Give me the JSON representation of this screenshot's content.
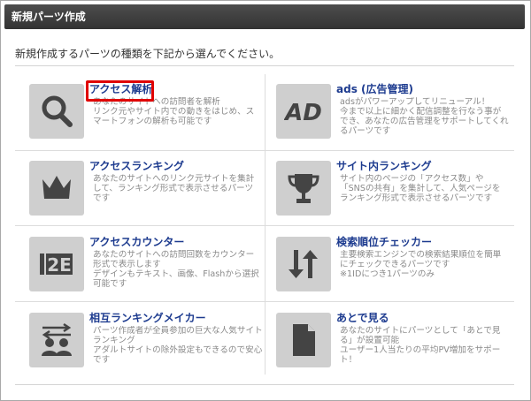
{
  "header": {
    "title": "新規パーツ作成"
  },
  "intro": "新規作成するパーツの種類を下記から選んでください。",
  "items": [
    {
      "title": "アクセス解析",
      "icon": "magnifier-icon",
      "desc": [
        "あなたのサイトへの訪問者を解析",
        "リンク元やサイト内での動きをはじめ、ス",
        "マートフォンの解析も可能です"
      ]
    },
    {
      "title": "ads (広告管理)",
      "icon": "ad-icon",
      "desc": [
        "adsがパワーアップしてリニューアル！",
        "今まで以上に細かく配信調整を行なう事が",
        "でき、あなたの広告管理をサポートしてくれ",
        "るパーツです"
      ]
    },
    {
      "title": "アクセスランキング",
      "icon": "crown-icon",
      "desc": [
        "あなたのサイトへのリンク元サイトを集計",
        "して、ランキング形式で表示させるパーツ",
        "です"
      ]
    },
    {
      "title": "サイト内ランキング",
      "icon": "trophy-icon",
      "desc": [
        "サイト内のページの「アクセス数」や",
        "「SNSの共有」を集計して、人気ページを",
        "ランキング形式で表示させるパーツです"
      ]
    },
    {
      "title": "アクセスカウンター",
      "icon": "counter-icon",
      "desc": [
        "あなたのサイトへの訪問回数をカウンター",
        "形式で表示します",
        "デザインもテキスト、画像、Flashから選択",
        "可能です"
      ]
    },
    {
      "title": "検索順位チェッカー",
      "icon": "sort-arrows-icon",
      "desc": [
        "主要検索エンジンでの検索結果順位を簡単",
        "にチェックできるパーツです",
        "※1IDにつき1パーツのみ"
      ]
    },
    {
      "title": "相互ランキングメイカー",
      "icon": "users-exchange-icon",
      "desc": [
        "パーツ作成者が全員参加の巨大な人気サイト",
        "ランキング",
        "アダルトサイトの除外設定もできるので安心",
        "です"
      ]
    },
    {
      "title": "あとで見る",
      "icon": "document-icon",
      "desc": [
        "あなたのサイトにパーツとして「あとで見",
        "る」が設置可能",
        "ユーザー1人当たりの平均PV増加をサポー",
        "ト！"
      ]
    }
  ]
}
